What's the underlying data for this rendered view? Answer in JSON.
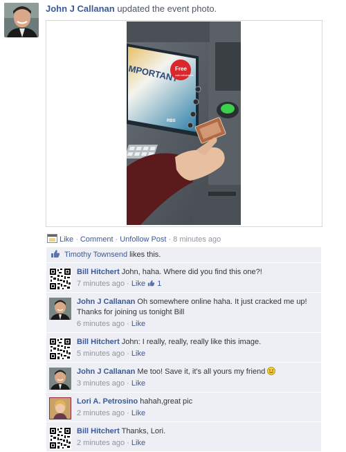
{
  "story": {
    "actor": "John J Callanan",
    "action": "updated the event photo."
  },
  "photo": {
    "screen_word": "MPORTANT",
    "sticker_word": "Free",
    "sticker_sub": "cash withdrawals",
    "bank_logo": "RBS"
  },
  "actions": {
    "like": "Like",
    "comment": "Comment",
    "unfollow": "Unfollow Post",
    "sep": "·",
    "time": "8 minutes ago"
  },
  "likes": {
    "name": "Timothy Townsend",
    "text": "likes this."
  },
  "comments": [
    {
      "name": "Bill Hitchert",
      "text": "John, haha. Where did you find this one?!",
      "time": "7 minutes ago",
      "like": "Like",
      "like_count": "1",
      "avatar": "qr-code-avatar"
    },
    {
      "name": "John J Callanan",
      "text": "Oh somewhere online haha. It just cracked me up! Thanks for joining us tonight Bill",
      "time": "6 minutes ago",
      "like": "Like",
      "avatar": "man-avatar"
    },
    {
      "name": "Bill Hitchert",
      "text": "John: I really, really, really like this image.",
      "time": "5 minutes ago",
      "like": "Like",
      "avatar": "qr-code-avatar"
    },
    {
      "name": "John J Callanan",
      "text": "Me too! Save it, it's all yours my friend",
      "time": "3 minutes ago",
      "like": "Like",
      "avatar": "man-avatar"
    },
    {
      "name": "Lori A. Petrosino",
      "text": "hahah,great pic",
      "time": "2 minutes ago",
      "like": "Like",
      "avatar": "woman-avatar"
    },
    {
      "name": "Bill Hitchert",
      "text": "Thanks, Lori.",
      "time": "2 minutes ago",
      "like": "Like",
      "avatar": "qr-code-avatar"
    }
  ],
  "colors": {
    "link": "#3b5998",
    "meta": "#90949c",
    "ufi_bg": "#edeff4"
  }
}
